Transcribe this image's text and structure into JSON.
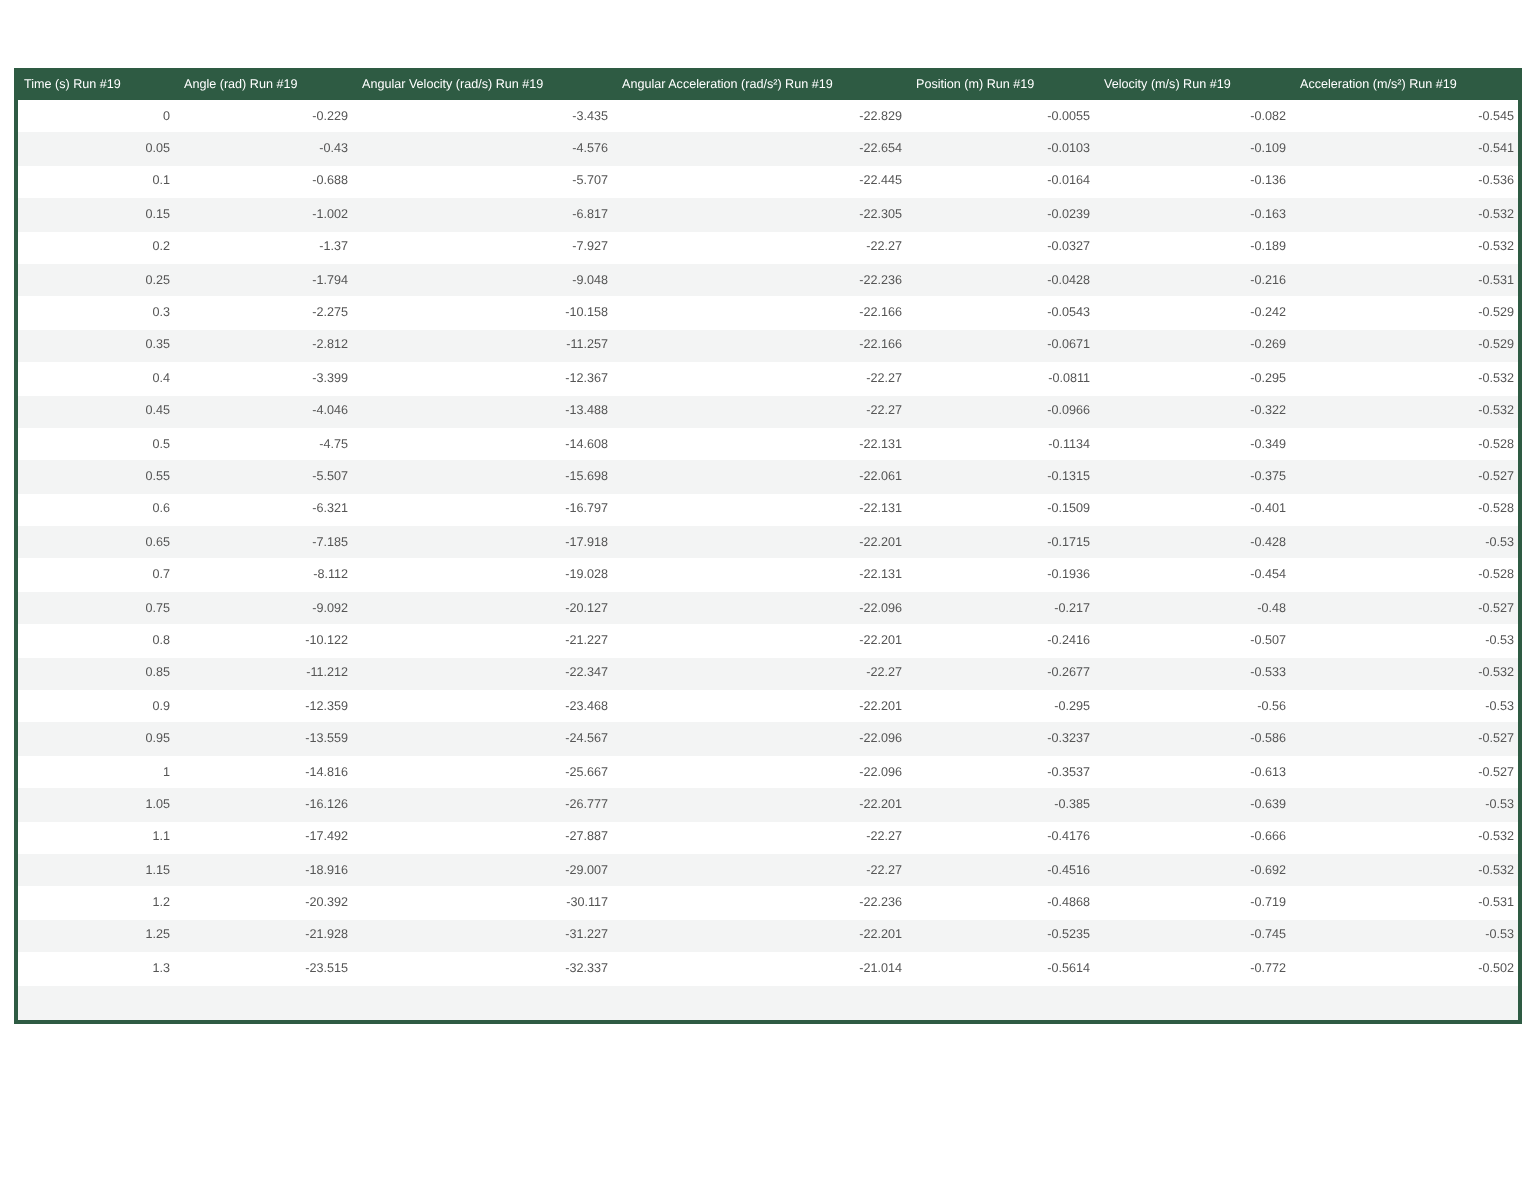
{
  "table": {
    "columns": [
      "Time (s) Run #19",
      "Angle (rad) Run #19",
      "Angular Velocity (rad/s) Run #19",
      "Angular Acceleration (rad/s²) Run #19",
      "Position (m) Run #19",
      "Velocity (m/s) Run #19",
      "Acceleration (m/s²) Run #19"
    ],
    "rows": [
      [
        "0",
        "-0.229",
        "-3.435",
        "-22.829",
        "-0.0055",
        "-0.082",
        "-0.545"
      ],
      [
        "0.05",
        "-0.43",
        "-4.576",
        "-22.654",
        "-0.0103",
        "-0.109",
        "-0.541"
      ],
      [
        "0.1",
        "-0.688",
        "-5.707",
        "-22.445",
        "-0.0164",
        "-0.136",
        "-0.536"
      ],
      [
        "0.15",
        "-1.002",
        "-6.817",
        "-22.305",
        "-0.0239",
        "-0.163",
        "-0.532"
      ],
      [
        "0.2",
        "-1.37",
        "-7.927",
        "-22.27",
        "-0.0327",
        "-0.189",
        "-0.532"
      ],
      [
        "0.25",
        "-1.794",
        "-9.048",
        "-22.236",
        "-0.0428",
        "-0.216",
        "-0.531"
      ],
      [
        "0.3",
        "-2.275",
        "-10.158",
        "-22.166",
        "-0.0543",
        "-0.242",
        "-0.529"
      ],
      [
        "0.35",
        "-2.812",
        "-11.257",
        "-22.166",
        "-0.0671",
        "-0.269",
        "-0.529"
      ],
      [
        "0.4",
        "-3.399",
        "-12.367",
        "-22.27",
        "-0.0811",
        "-0.295",
        "-0.532"
      ],
      [
        "0.45",
        "-4.046",
        "-13.488",
        "-22.27",
        "-0.0966",
        "-0.322",
        "-0.532"
      ],
      [
        "0.5",
        "-4.75",
        "-14.608",
        "-22.131",
        "-0.1134",
        "-0.349",
        "-0.528"
      ],
      [
        "0.55",
        "-5.507",
        "-15.698",
        "-22.061",
        "-0.1315",
        "-0.375",
        "-0.527"
      ],
      [
        "0.6",
        "-6.321",
        "-16.797",
        "-22.131",
        "-0.1509",
        "-0.401",
        "-0.528"
      ],
      [
        "0.65",
        "-7.185",
        "-17.918",
        "-22.201",
        "-0.1715",
        "-0.428",
        "-0.53"
      ],
      [
        "0.7",
        "-8.112",
        "-19.028",
        "-22.131",
        "-0.1936",
        "-0.454",
        "-0.528"
      ],
      [
        "0.75",
        "-9.092",
        "-20.127",
        "-22.096",
        "-0.217",
        "-0.48",
        "-0.527"
      ],
      [
        "0.8",
        "-10.122",
        "-21.227",
        "-22.201",
        "-0.2416",
        "-0.507",
        "-0.53"
      ],
      [
        "0.85",
        "-11.212",
        "-22.347",
        "-22.27",
        "-0.2677",
        "-0.533",
        "-0.532"
      ],
      [
        "0.9",
        "-12.359",
        "-23.468",
        "-22.201",
        "-0.295",
        "-0.56",
        "-0.53"
      ],
      [
        "0.95",
        "-13.559",
        "-24.567",
        "-22.096",
        "-0.3237",
        "-0.586",
        "-0.527"
      ],
      [
        "1",
        "-14.816",
        "-25.667",
        "-22.096",
        "-0.3537",
        "-0.613",
        "-0.527"
      ],
      [
        "1.05",
        "-16.126",
        "-26.777",
        "-22.201",
        "-0.385",
        "-0.639",
        "-0.53"
      ],
      [
        "1.1",
        "-17.492",
        "-27.887",
        "-22.27",
        "-0.4176",
        "-0.666",
        "-0.532"
      ],
      [
        "1.15",
        "-18.916",
        "-29.007",
        "-22.27",
        "-0.4516",
        "-0.692",
        "-0.532"
      ],
      [
        "1.2",
        "-20.392",
        "-30.117",
        "-22.236",
        "-0.4868",
        "-0.719",
        "-0.531"
      ],
      [
        "1.25",
        "-21.928",
        "-31.227",
        "-22.201",
        "-0.5235",
        "-0.745",
        "-0.53"
      ],
      [
        "1.3",
        "-23.515",
        "-32.337",
        "-21.014",
        "-0.5614",
        "-0.772",
        "-0.502"
      ]
    ]
  }
}
